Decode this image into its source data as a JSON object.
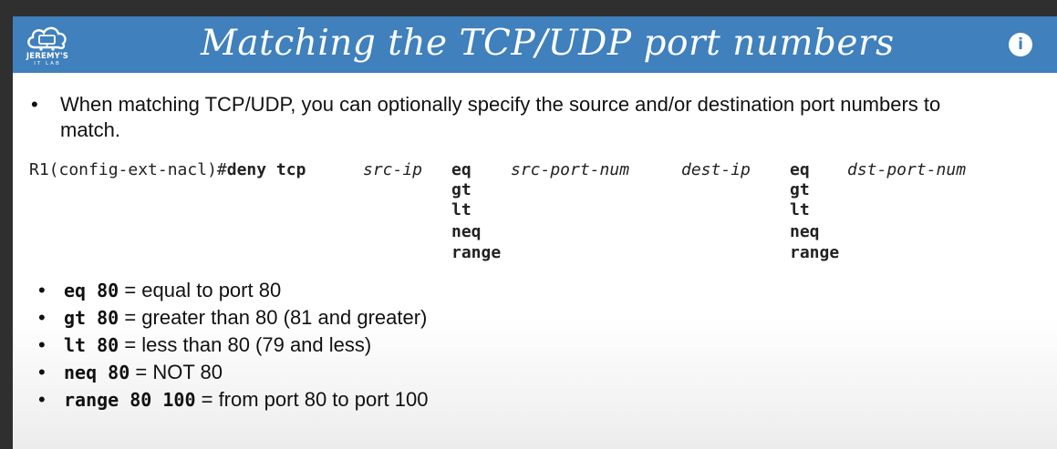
{
  "logo": {
    "line1": "JEREMY'S",
    "line2": "IT LAB"
  },
  "title": "Matching the TCP/UDP port numbers",
  "info_icon": "i",
  "intro": "When matching TCP/UDP, you can optionally specify the source and/or destination port numbers to match.",
  "bullet": "•",
  "command": {
    "prompt": "R1(config-ext-nacl)#",
    "keyword": "deny tcp",
    "src_ip": "src-ip",
    "src_ops": [
      "eq",
      "gt",
      "lt",
      "neq",
      "range"
    ],
    "src_port": "src-port-num",
    "dest_ip": "dest-ip",
    "dst_ops": [
      "eq",
      "gt",
      "lt",
      "neq",
      "range"
    ],
    "dst_port": "dst-port-num"
  },
  "examples": [
    {
      "code": "eq 80",
      "desc": " = equal to port 80"
    },
    {
      "code": "gt 80",
      "desc": " = greater than 80 (81 and greater)"
    },
    {
      "code": "lt 80",
      "desc": " = less than 80 (79 and less)"
    },
    {
      "code": "neq 80",
      "desc": " = NOT 80"
    },
    {
      "code": "range 80 100",
      "desc": " = from port 80 to port 100"
    }
  ],
  "colors": {
    "title_bar": "#3f80bd",
    "background": "#2f2f2f"
  }
}
